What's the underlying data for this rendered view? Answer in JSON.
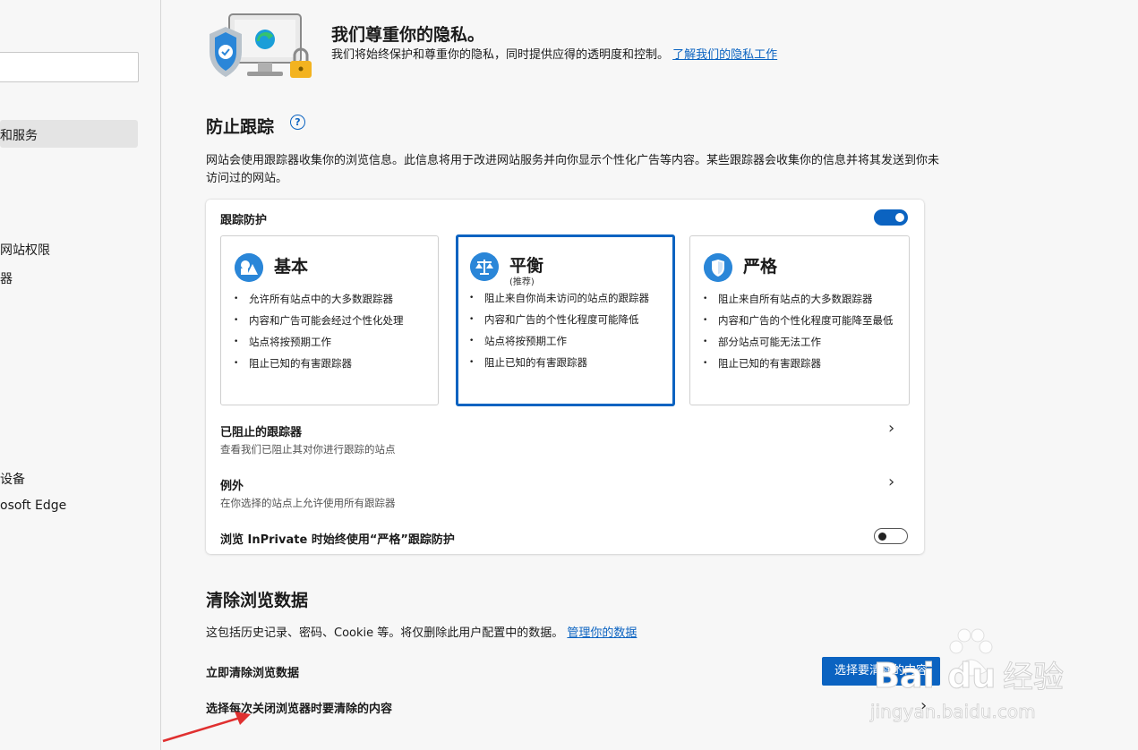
{
  "sidebar": {
    "items": [
      {
        "label": "隐私、搜索和服务",
        "visible": "和服务"
      },
      {
        "label": "Cookie 和网站权限",
        "visible": "网站权限"
      },
      {
        "label": "默认浏览器",
        "visible": "器"
      },
      {
        "label": "手机和其他设备",
        "visible": "设备"
      },
      {
        "label": "关于 Microsoft Edge",
        "visible": "osoft Edge"
      }
    ]
  },
  "privacy": {
    "title": "我们尊重你的隐私。",
    "desc": "我们将始终保护和尊重你的隐私，同时提供应得的透明度和控制。",
    "link": "了解我们的隐私工作"
  },
  "tracking": {
    "title": "防止跟踪",
    "help": "?",
    "desc": "网站会使用跟踪器收集你的浏览信息。此信息将用于改进网站服务并向你显示个性化广告等内容。某些跟踪器会收集你的信息并将其发送到你未访问过的网站。",
    "protection_label": "跟踪防护",
    "protection_on": true,
    "options": [
      {
        "title": "基本",
        "subtitle": "",
        "selected": false,
        "icon": "basic-shapes-icon",
        "bullets": [
          "允许所有站点中的大多数跟踪器",
          "内容和广告可能会经过个性化处理",
          "站点将按预期工作",
          "阻止已知的有害跟踪器"
        ]
      },
      {
        "title": "平衡",
        "subtitle": "(推荐)",
        "selected": true,
        "icon": "scale-icon",
        "bullets": [
          "阻止来自你尚未访问的站点的跟踪器",
          "内容和广告的个性化程度可能降低",
          "站点将按预期工作",
          "阻止已知的有害跟踪器"
        ]
      },
      {
        "title": "严格",
        "subtitle": "",
        "selected": false,
        "icon": "shield-icon",
        "bullets": [
          "阻止来自所有站点的大多数跟踪器",
          "内容和广告的个性化程度可能降至最低",
          "部分站点可能无法工作",
          "阻止已知的有害跟踪器"
        ]
      }
    ],
    "blocked": {
      "title": "已阻止的跟踪器",
      "sub": "查看我们已阻止其对你进行跟踪的站点"
    },
    "exceptions": {
      "title": "例外",
      "sub": "在你选择的站点上允许使用所有跟踪器"
    },
    "inprivate": {
      "label": "浏览 InPrivate 时始终使用“严格”跟踪防护",
      "on": false
    }
  },
  "clear": {
    "title": "清除浏览数据",
    "desc": "这包括历史记录、密码、Cookie 等。将仅删除此用户配置中的数据。",
    "manage_link": "管理你的数据",
    "now_label": "立即清除浏览数据",
    "choose_button": "选择要清除的内容",
    "on_close_label": "选择每次关闭浏览器时要清除的内容"
  },
  "watermark": {
    "brand": "Bai",
    "brand2": "du",
    "cn": "经验",
    "url": "jingyan.baidu.com"
  },
  "colors": {
    "accent": "#0b63c1",
    "card": "#ffffff",
    "bg": "#f7f7f7",
    "arrow": "#e03030"
  }
}
